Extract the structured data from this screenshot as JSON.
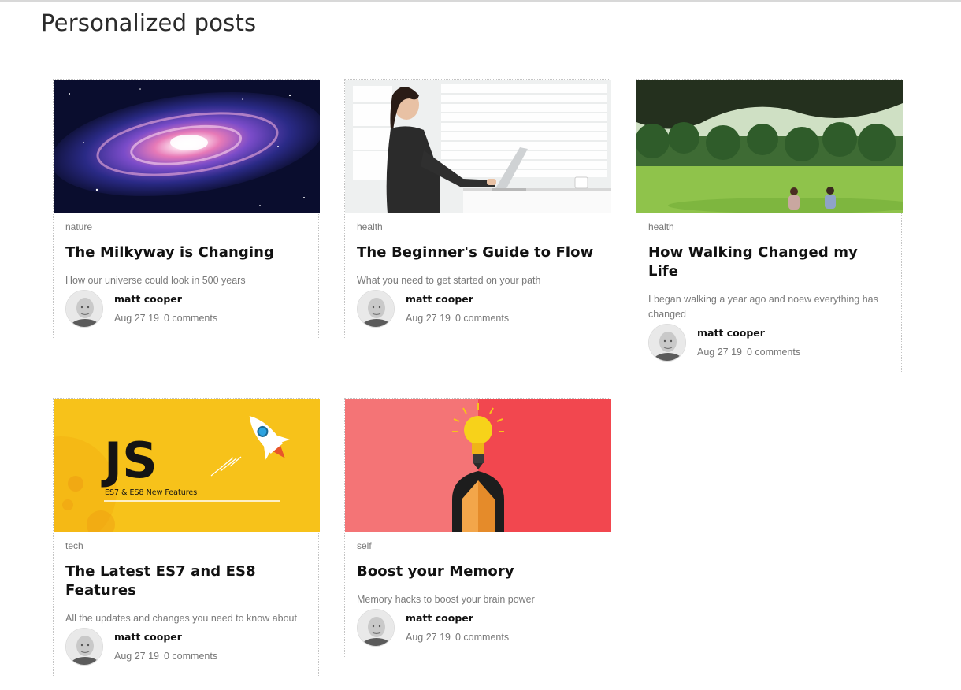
{
  "page": {
    "title": "Personalized posts"
  },
  "posts": [
    {
      "image": "milky-way-galaxy-image",
      "category": "nature",
      "title": "The Milkyway is Changing",
      "excerpt": "How our universe could look in 500 years",
      "author": "matt cooper",
      "date": "Aug 27 19",
      "comments": "0 comments"
    },
    {
      "image": "woman-at-laptop-image",
      "category": "health",
      "title": "The Beginner's Guide to Flow",
      "excerpt": "What you need to get started on your path",
      "author": "matt cooper",
      "date": "Aug 27 19",
      "comments": "0 comments"
    },
    {
      "image": "park-walk-image",
      "category": "health",
      "title": "How Walking Changed my Life",
      "excerpt": "I began walking a year ago and noew everything has changed",
      "author": "matt cooper",
      "date": "Aug 27 19",
      "comments": "0 comments"
    },
    {
      "image": "js-rocket-banner-image",
      "image_text": {
        "logo": "JS",
        "subtitle": "ES7 & ES8 New Features"
      },
      "category": "tech",
      "title": "The Latest ES7 and ES8 Features",
      "excerpt": "All the updates and changes you need to know about",
      "author": "matt cooper",
      "date": "Aug 27 19",
      "comments": "0 comments"
    },
    {
      "image": "lightbulb-pencil-image",
      "category": "self",
      "title": "Boost your Memory",
      "excerpt": "Memory hacks to boost your brain power",
      "author": "matt cooper",
      "date": "Aug 27 19",
      "comments": "0 comments"
    }
  ],
  "colors": {
    "title": "#111111",
    "muted": "#777777",
    "border": "#c4c4c4",
    "js_yellow": "#f7c21a",
    "memory_red": "#f25a5f"
  }
}
